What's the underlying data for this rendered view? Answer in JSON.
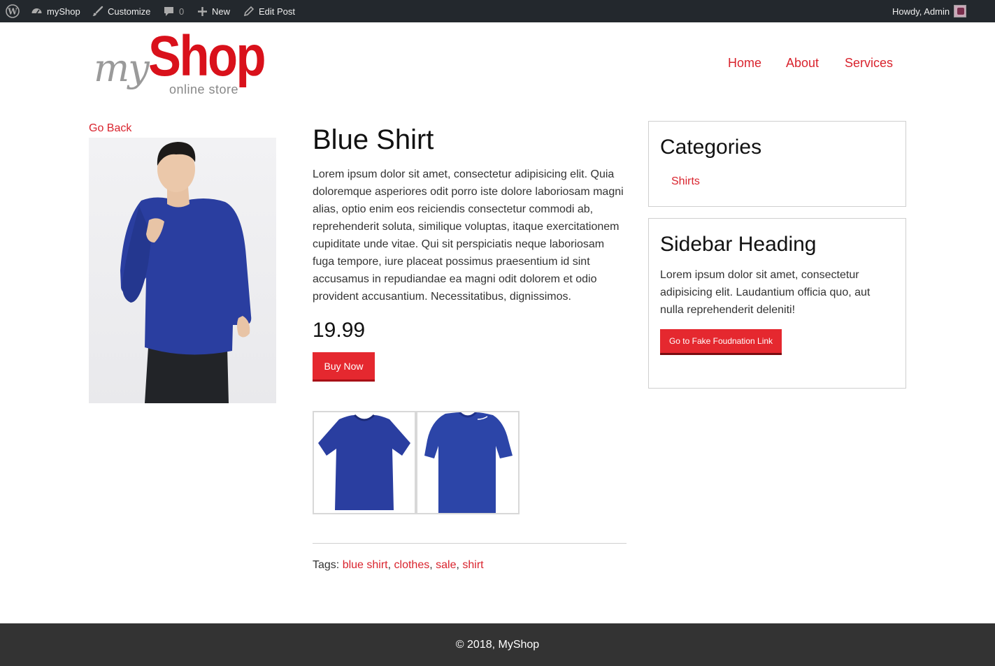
{
  "adminbar": {
    "site_name": "myShop",
    "customize": "Customize",
    "comments_count": "0",
    "new_label": "New",
    "edit_post": "Edit Post",
    "howdy": "Howdy, Admin"
  },
  "header": {
    "logo_my": "my",
    "logo_shop": "Shop",
    "logo_tagline": "online store",
    "nav": [
      "Home",
      "About",
      "Services"
    ]
  },
  "product": {
    "go_back": "Go Back",
    "title": "Blue Shirt",
    "description": "Lorem ipsum dolor sit amet, consectetur adipisicing elit. Quia doloremque asperiores odit porro iste dolore laboriosam magni alias, optio enim eos reiciendis consectetur commodi ab, reprehenderit soluta, similique voluptas, itaque exercitationem cupiditate unde vitae. Qui sit perspiciatis neque laboriosam fuga tempore, iure placeat possimus praesentium id sint accusamus in repudiandae ea magni odit dolorem et odio provident accusantium. Necessitatibus, dignissimos.",
    "price": "19.99",
    "buy_label": "Buy Now",
    "tags_label": "Tags:",
    "tags": [
      "blue shirt",
      "clothes",
      "sale",
      "shirt"
    ]
  },
  "sidebar": {
    "categories_title": "Categories",
    "categories": [
      "Shirts"
    ],
    "heading": "Sidebar Heading",
    "text": "Lorem ipsum dolor sit amet, consectetur adipisicing elit. Laudantium officia quo, aut nulla reprehenderit deleniti!",
    "button_label": "Go to Fake Foudnation Link"
  },
  "footer": {
    "copyright": "© 2018, MyShop"
  },
  "colors": {
    "accent": "#e5282f",
    "link": "#d9232d",
    "adminbar": "#23282d",
    "footer": "#333333",
    "shirt": "#2a3ea0"
  }
}
